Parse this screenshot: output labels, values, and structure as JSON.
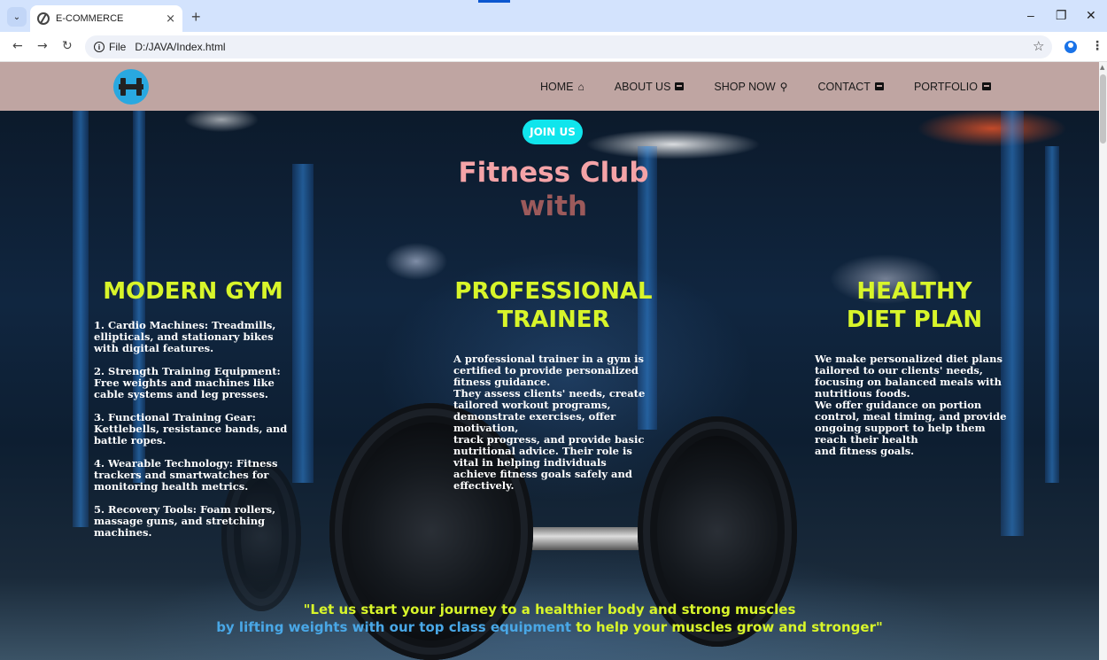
{
  "browser": {
    "tab_title": "E-COMMERCE",
    "tab_close": "×",
    "new_tab": "+",
    "file_label": "File",
    "url": "D:/JAVA/Index.html",
    "window_controls": [
      "–",
      "❐",
      "✕"
    ]
  },
  "site": {
    "nav": {
      "home": "HOME",
      "about": "ABOUT US",
      "shop": "SHOP NOW",
      "contact": "CONTACT",
      "portfolio": "PORTFOLIO"
    },
    "join_label": "JOIN US",
    "hero_title": "Fitness Club",
    "hero_subtitle": "with",
    "columns": [
      {
        "heading": "MODERN GYM",
        "items": [
          "1. Cardio Machines: Treadmills, ellipticals, and stationary bikes with digital features.",
          "2. Strength Training Equipment: Free weights and machines like cable systems and leg presses.",
          "3. Functional Training Gear: Kettlebells, resistance bands, and battle ropes.",
          "4. Wearable Technology: Fitness trackers and smartwatches for monitoring health metrics.",
          "5. Recovery Tools: Foam rollers, massage guns, and stretching machines."
        ]
      },
      {
        "heading_line1": "PROFESSIONAL",
        "heading_line2": "TRAINER",
        "lines": [
          "A professional trainer in a gym is certified to provide personalized fitness guidance.",
          "They assess clients' needs, create tailored workout programs, demonstrate exercises, offer motivation,",
          "track progress, and provide basic nutritional advice. Their role is vital in helping individuals achieve fitness goals safely and effectively."
        ]
      },
      {
        "heading_line1": "HEALTHY",
        "heading_line2": "DIET PLAN",
        "lines": [
          "We make personalized diet plans tailored to our clients' needs, focusing on balanced meals with nutritious foods.",
          "We offer guidance on portion control, meal timing, and provide ongoing support to help them reach their health",
          "and fitness goals."
        ]
      }
    ],
    "quote_line1": "\"Let us start your journey to a healthier body and strong muscles",
    "quote_line2a": "by lifting weights with our top class equipment",
    "quote_line2b": " to help your muscles grow and stronger\""
  },
  "colors": {
    "nav_bg": "#bfa5a2",
    "join_bg": "#10e5ec",
    "heading": "#d8f52a",
    "title_pink": "#f4a3a7",
    "subtitle": "#9c5a5b",
    "quote_blue": "#49a7e6"
  },
  "icons": {
    "home": "home-icon",
    "about": "card-icon",
    "shop": "search-icon",
    "contact": "contact-card-icon",
    "portfolio": "portfolio-card-icon",
    "logo": "dumbbell-logo-icon"
  }
}
